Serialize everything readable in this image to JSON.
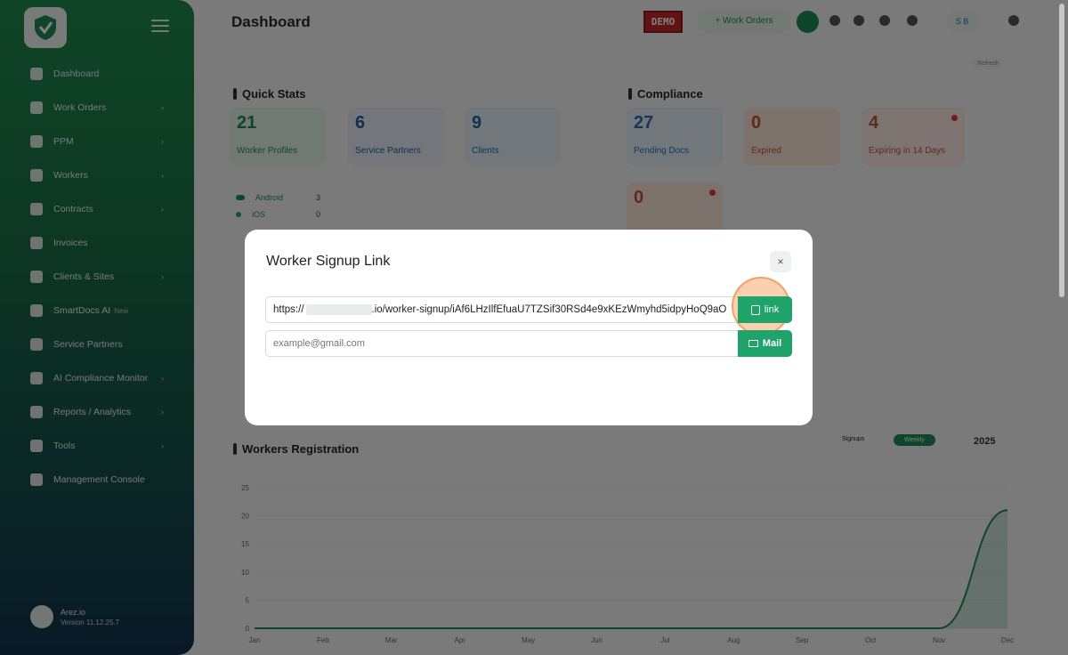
{
  "header": {
    "title": "Dashboard",
    "demo_badge": "DEMO",
    "work_orders_button": "+ Work Orders",
    "language": "S B",
    "refresh": "Refresh"
  },
  "sidebar": {
    "items": [
      {
        "label": "Dashboard",
        "icon": "dashboard-icon"
      },
      {
        "label": "Work Orders",
        "icon": "briefcase-icon",
        "has_chevron": true
      },
      {
        "label": "PPM",
        "icon": "clipboard-icon",
        "has_chevron": true
      },
      {
        "label": "Workers",
        "icon": "user-icon",
        "has_chevron": true
      },
      {
        "label": "Contracts",
        "icon": "document-icon",
        "has_chevron": true
      },
      {
        "label": "Invoices",
        "icon": "invoice-icon"
      },
      {
        "label": "Clients & Sites",
        "icon": "users-icon",
        "has_chevron": true
      },
      {
        "label": "SmartDocs AI",
        "tag": "New",
        "icon": "smartdocs-icon"
      },
      {
        "label": "Service Partners",
        "icon": "handshake-icon"
      },
      {
        "label": "AI Compliance Monitor",
        "icon": "robot-icon",
        "has_chevron": true
      },
      {
        "label": "Reports / Analytics",
        "icon": "chart-icon",
        "has_chevron": true
      },
      {
        "label": "Tools",
        "icon": "wrench-icon",
        "has_chevron": true
      },
      {
        "label": "Management Console",
        "icon": "gears-icon"
      }
    ],
    "footer": {
      "name": "Arez.io",
      "version": "Version 11.12.25.7"
    }
  },
  "quick_stats": {
    "title": "Quick Stats",
    "cards": [
      {
        "value": "21",
        "label": "Worker Profiles"
      },
      {
        "value": "6",
        "label": "Service Partners"
      },
      {
        "value": "9",
        "label": "Clients"
      }
    ],
    "legend": [
      {
        "label": "Android",
        "count": "3"
      },
      {
        "label": "iOS",
        "count": "0"
      }
    ]
  },
  "compliance": {
    "title": "Compliance",
    "cards": [
      {
        "value": "27",
        "label": "Pending Docs"
      },
      {
        "value": "0",
        "label": "Expired"
      },
      {
        "value": "4",
        "label": "Expiring in 14 Days"
      },
      {
        "value": "0",
        "label": ""
      }
    ]
  },
  "workers_registration": {
    "title": "Workers Registration",
    "toggle_left": "Signups",
    "toggle_right": "Weekly",
    "year": "2025"
  },
  "modal": {
    "title": "Worker Signup Link",
    "close": "×",
    "link_prefix": "https://",
    "link_suffix": ".io/worker-signup/iAf6LHzIlfEfuaU7TZSif30RSd4e9xKEzWmyhd5idpyHoQ9aO",
    "copy_label": "link",
    "email_placeholder": "example@gmail.com",
    "mail_label": "Mail"
  },
  "chart_data": {
    "type": "area",
    "title": "Workers Registration",
    "categories": [
      "Jan",
      "Feb",
      "Mar",
      "Apr",
      "May",
      "Jun",
      "Jul",
      "Aug",
      "Sep",
      "Oct",
      "Nov",
      "Dec"
    ],
    "values": [
      0,
      0,
      0,
      0,
      0,
      0,
      0,
      0,
      0,
      0,
      0,
      21
    ],
    "yticks": [
      "25",
      "20",
      "15",
      "10",
      "5",
      "0"
    ],
    "ylim": [
      0,
      25
    ],
    "series_color": "#1e8a55"
  },
  "colors": {
    "accent": "#1fa36a",
    "brand_green": "#1e8a55",
    "demo_red": "#c9272b"
  }
}
